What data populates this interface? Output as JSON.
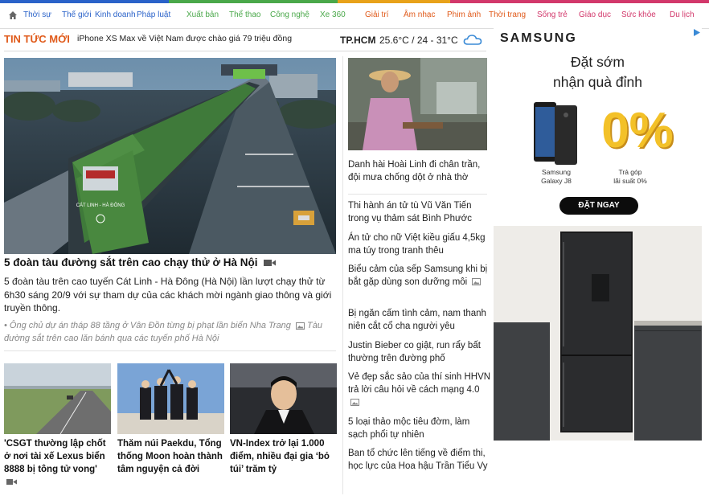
{
  "nav": {
    "home_icon": "home-icon",
    "items": [
      {
        "label": "Thời sự",
        "color": "#2a62c9"
      },
      {
        "label": "Thế giới",
        "color": "#2a62c9"
      },
      {
        "label": "Kinh doanh",
        "color": "#2a62c9"
      },
      {
        "label": "Pháp luật",
        "color": "#2a62c9"
      },
      {
        "label": "Xuất bản",
        "color": "#4aa84a"
      },
      {
        "label": "Thể thao",
        "color": "#4aa84a"
      },
      {
        "label": "Công nghệ",
        "color": "#4aa84a"
      },
      {
        "label": "Xe 360",
        "color": "#4aa84a"
      },
      {
        "label": "Giải trí",
        "color": "#e05a1a"
      },
      {
        "label": "Âm nhạc",
        "color": "#e05a1a"
      },
      {
        "label": "Phim ảnh",
        "color": "#e05a1a"
      },
      {
        "label": "Thời trang",
        "color": "#e05a1a"
      },
      {
        "label": "Sống trẻ",
        "color": "#d2386b"
      },
      {
        "label": "Giáo dục",
        "color": "#d2386b"
      },
      {
        "label": "Sức khỏe",
        "color": "#d2386b"
      },
      {
        "label": "Du lịch",
        "color": "#d2386b"
      }
    ]
  },
  "ticker": {
    "label": "TIN TỨC MỚI",
    "headline": "iPhone XS Max về Việt Nam được chào giá 79 triệu đồng",
    "weather_city": "TP.HCM",
    "weather_temp": "25.6°C / 24 - 31°C",
    "weather_icon": "cloud-icon"
  },
  "main_story": {
    "title": "5 đoàn tàu đường sắt trên cao chạy thử ở Hà Nội",
    "description": "5 đoàn tàu trên cao tuyến Cát Linh - Hà Đông (Hà Nội) lần lượt chạy thử từ 6h30 sáng 20/9 với sự tham dự của các khách mời ngành giao thông và giới truyền thông.",
    "related_1": "• Ông chủ dự án tháp 88 tầng ở Vân Đồn từng bị phạt lần biển Nha Trang",
    "related_2": "Tàu đường sắt trên cao lăn bánh qua các tuyến phố Hà Nội",
    "train_sign": "CÁT LINH - HÀ ĐÔNG"
  },
  "sub_stories": [
    {
      "title": "'CSGT thường lập chốt ở nơi tài xế Lexus biển 8888 bị tông tử vong'"
    },
    {
      "title": "Thăm núi Paekdu, Tổng thống Moon hoàn thành tâm nguyện cả đời"
    },
    {
      "title": "VN-Index trở lại 1.000 điểm, nhiều đại gia ‘bỏ túi’ trăm tỷ"
    }
  ],
  "side_list": {
    "first": "Danh hài Hoài Linh đi chân trần, đội mưa chống dột ở nhà thờ",
    "items": [
      {
        "text": "Thi hành án tử tù Vũ Văn Tiến trong vụ thảm sát Bình Phước"
      },
      {
        "text": "Án tử cho nữ Việt kiều giấu 4,5kg ma túy trong tranh thêu"
      },
      {
        "text": "Biểu cảm của sếp Samsung khi bị bắt gặp dùng son dưỡng môi"
      },
      {
        "text": "Bị ngăn cấm tình cảm, nam thanh niên cắt cổ cha người yêu"
      },
      {
        "text": "Justin Bieber co giật, run rẩy bất thường trên đường phố"
      },
      {
        "text": "Vẻ đẹp sắc sảo của thí sinh HHVN trả lời câu hỏi về cách mạng 4.0"
      },
      {
        "text": "5 loại thảo mộc tiêu đờm, làm sạch phổi tự nhiên"
      },
      {
        "text": "Ban tổ chức lên tiếng về điểm thi, học lực của Hoa hậu Trần Tiểu Vy"
      }
    ]
  },
  "ad": {
    "brand": "SAMSUNG",
    "headline_1": "Đặt sớm",
    "headline_2": "nhận quà đỉnh",
    "phone_label_1": "Samsung",
    "phone_label_2": "Galaxy J8",
    "offer_big": "0%",
    "offer_label_1": "Trả góp",
    "offer_label_2": "lãi suất 0%",
    "cta": "ĐẶT NGAY"
  }
}
